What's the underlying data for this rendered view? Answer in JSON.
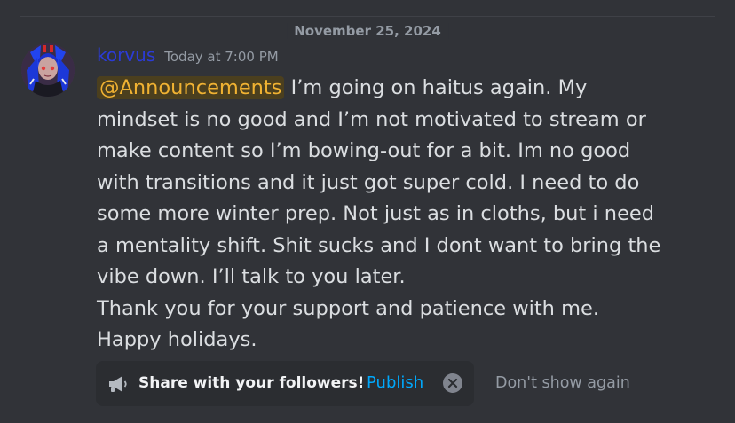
{
  "divider": {
    "date": "November 25, 2024"
  },
  "message": {
    "author": "korvus",
    "timestamp": "Today at 7:00 PM",
    "mention": "@Announcements",
    "lines": [
      " I’m going on haitus again. My",
      "mindset is no good and I’m not motivated to stream or",
      "make content so I’m bowing-out for a bit. Im no good",
      "with transitions and it just got super cold. I need to do",
      "some more winter prep. Not just as in cloths, but i need",
      "a mentality shift. Shit sucks and I dont want to bring the",
      "vibe down. I’ll talk to you later.",
      "Thank you for your support and patience with me.",
      "Happy holidays."
    ]
  },
  "share_prompt": {
    "icon": "megaphone-icon",
    "text": "Share with your followers!",
    "publish_label": "Publish",
    "dismiss_icon": "close-icon",
    "dont_show_label": "Don't show again"
  },
  "colors": {
    "background": "#313338",
    "username": "#2b3bd6",
    "mention_bg": "#4b3f1e",
    "mention_text": "#f0b232",
    "link": "#00a8fc"
  }
}
